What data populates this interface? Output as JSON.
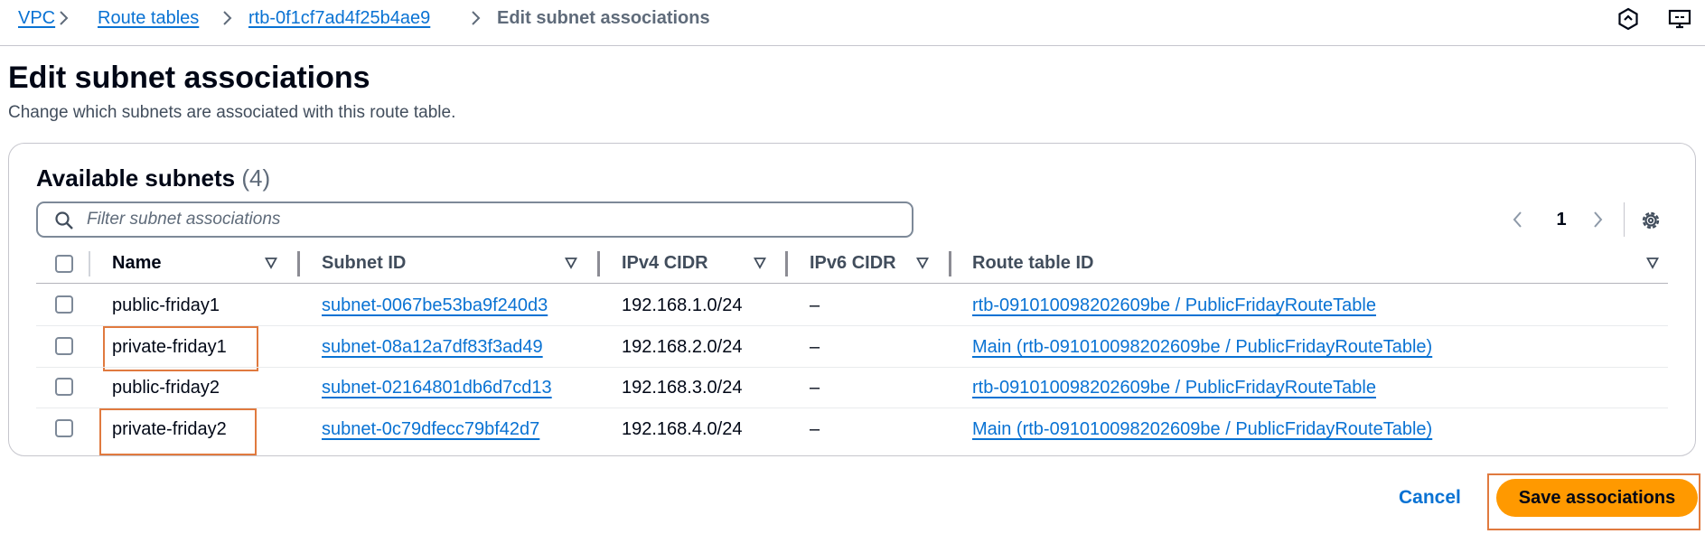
{
  "breadcrumb": {
    "items": [
      {
        "label": "VPC"
      },
      {
        "label": "Route tables"
      },
      {
        "label": "rtb-0f1cf7ad4f25b4ae9"
      },
      {
        "label": "Edit subnet associations"
      }
    ]
  },
  "header_icons": [
    "feedback-hexagon-icon",
    "notifications-screen-icon"
  ],
  "page": {
    "title": "Edit subnet associations",
    "description": "Change which subnets are associated with this route table."
  },
  "panel": {
    "title": "Available subnets",
    "count": "(4)",
    "filter_placeholder": "Filter subnet associations",
    "page_number": "1",
    "columns": [
      "Name",
      "Subnet ID",
      "IPv4 CIDR",
      "IPv6 CIDR",
      "Route table ID"
    ],
    "rows": [
      {
        "name": "public-friday1",
        "subnet_id": "subnet-0067be53ba9f240d3",
        "ipv4": "192.168.1.0/24",
        "ipv6": "–",
        "route_table": "rtb-091010098202609be / PublicFridayRouteTable",
        "selected": false,
        "highlighted": false
      },
      {
        "name": "private-friday1",
        "subnet_id": "subnet-08a12a7df83f3ad49",
        "ipv4": "192.168.2.0/24",
        "ipv6": "–",
        "route_table": "Main (rtb-091010098202609be / PublicFridayRouteTable)",
        "selected": false,
        "highlighted": true
      },
      {
        "name": "public-friday2",
        "subnet_id": "subnet-02164801db6d7cd13",
        "ipv4": "192.168.3.0/24",
        "ipv6": "–",
        "route_table": "rtb-091010098202609be / PublicFridayRouteTable",
        "selected": false,
        "highlighted": false
      },
      {
        "name": "private-friday2",
        "subnet_id": "subnet-0c79dfecc79bf42d7",
        "ipv4": "192.168.4.0/24",
        "ipv6": "–",
        "route_table": "Main (rtb-091010098202609be / PublicFridayRouteTable)",
        "selected": false,
        "highlighted": true
      }
    ]
  },
  "actions": {
    "cancel_label": "Cancel",
    "save_label": "Save associations"
  },
  "colors": {
    "link": "#0972d3",
    "primary_button": "#ff9900",
    "highlight_box": "#e07a3f"
  }
}
